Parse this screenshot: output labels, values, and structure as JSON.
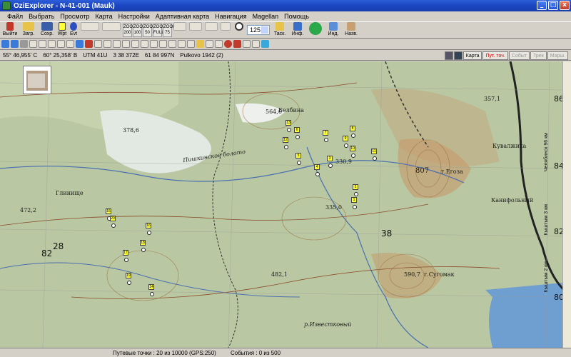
{
  "window": {
    "title": "OziExplorer - N-41-001 (Mauk)",
    "buttons": [
      "_",
      "□",
      "x"
    ]
  },
  "menu": [
    "Файл",
    "Выбрать",
    "Просмотр",
    "Карта",
    "Настройки",
    "Адаптивная карта",
    "Навигация",
    "Magellan",
    "Помощь"
  ],
  "toolbar": {
    "exit": "Выйти",
    "load": "Загр.",
    "save": "Сохр.",
    "wpt": "Wpt",
    "evt": "Evt",
    "zoom_value": "125",
    "track_label": "Таск.",
    "info_label": "Инф.",
    "ind_label": "Инд.",
    "nav_label": "Назв.",
    "zoom_buttons": [
      "ZOOM 200",
      "ZOOM 100",
      "ZOOM 50",
      "ZOOM FULL",
      "ZOOM 75"
    ]
  },
  "status": {
    "lat": "55° 46,955' С",
    "lon": "60° 25,358' В",
    "utm": "UTM 41U",
    "easting": "3 38 372E",
    "northing": "61 84 997N",
    "datum": "Pulkovo 1942 (2)"
  },
  "right_tabs": [
    "Карта",
    "Пут. точ.",
    "Событ",
    "Трек",
    "Марш."
  ],
  "bottom": {
    "waypoints": "Путевые точки : 20 из 10000  (GPS:250)",
    "events": "События : 0 из 500"
  },
  "map": {
    "labels": [
      {
        "text": "Пишкинское болото"
      },
      {
        "text": "Белбина"
      },
      {
        "text": "г.Егоза"
      },
      {
        "text": "Кувалжиха"
      },
      {
        "text": "Канифольный"
      },
      {
        "text": "г.Сугомак"
      },
      {
        "text": "р.Известковый"
      },
      {
        "text": "Глинище"
      },
      {
        "text": "Челябинск 96 км"
      },
      {
        "text": "Кыштым 3 км"
      },
      {
        "text": "Кыштым 2 км"
      },
      {
        "text": "378,6"
      },
      {
        "text": "564,6"
      },
      {
        "text": "807"
      },
      {
        "text": "330,9"
      },
      {
        "text": "335,0"
      },
      {
        "text": "472,2"
      },
      {
        "text": "482,1"
      },
      {
        "text": "590,7"
      },
      {
        "text": "357,1"
      }
    ],
    "grid_numbers": [
      "86",
      "84",
      "82",
      "80",
      "82",
      "28",
      "38"
    ],
    "waypoints": [
      "13",
      "6",
      "7",
      "8",
      "12",
      "9",
      "10",
      "11",
      "5",
      "4",
      "3",
      "2",
      "1",
      "15",
      "20",
      "16",
      "18",
      "17",
      "19",
      "14"
    ]
  },
  "colors": {
    "title_bar": "#1b45c2",
    "map_bg": "#b9c8a2",
    "waypoint": "#ffff33"
  }
}
